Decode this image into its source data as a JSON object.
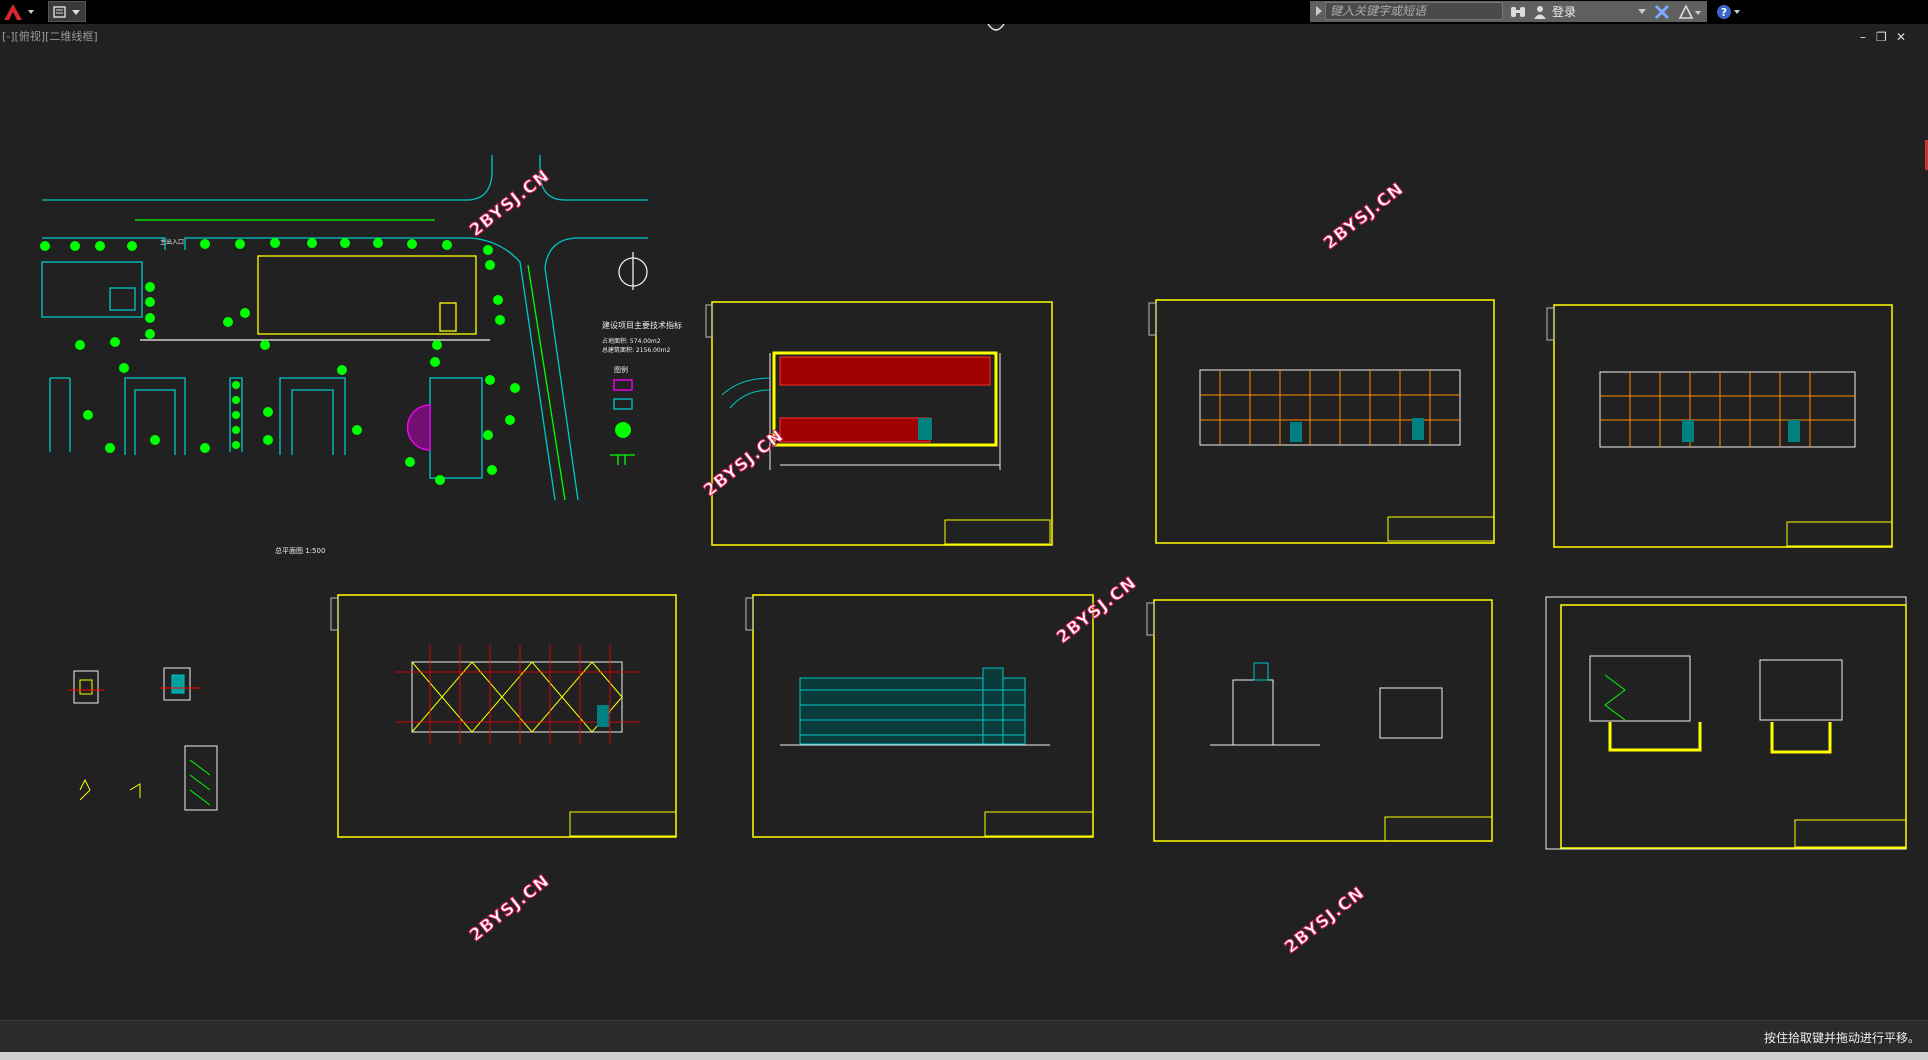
{
  "titlebar": {
    "logo_icon": "autocad-a-logo-icon",
    "qat_icon": "quick-access-toolbar-icon",
    "search_placeholder": "键入关键字或短语",
    "search_icon": "binoculars-search-icon",
    "user_icon": "user-icon",
    "login_label": "登录",
    "exchange_icon": "exchange-x-icon",
    "stay_connected_icon": "stay-connected-icon",
    "help_icon": "help-icon"
  },
  "viewport": {
    "label": "[-][俯视][二维线框]",
    "window_controls": {
      "minimize": "–",
      "restore": "❐",
      "close": "✕"
    }
  },
  "drawing": {
    "watermark": "2BYSJ.CN",
    "site_plan": {
      "legend_title": "建设项目主要技术指标",
      "legend_lines": [
        "占地面积: 574.00m2",
        "总建筑面积: 2156.00m2"
      ],
      "legend_heading": "图例",
      "plan_title": "总平面图 1:500",
      "entrance_label": "主出入口"
    }
  },
  "colors": {
    "background": "#212121",
    "sheet_border": "#ffff00",
    "road_line": "#00c8c8",
    "tree_green": "#00ff00",
    "wall_red": "#ff0000",
    "watermark_stroke": "#e0245e"
  },
  "status": {
    "message": "按住拾取键并拖动进行平移。"
  }
}
